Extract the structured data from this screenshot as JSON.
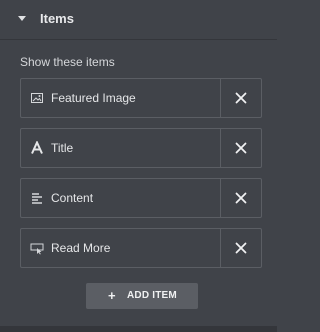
{
  "section": {
    "title": "Items"
  },
  "field": {
    "label": "Show these items"
  },
  "items": [
    {
      "label": "Featured Image",
      "icon": "image-icon"
    },
    {
      "label": "Title",
      "icon": "title-text-icon"
    },
    {
      "label": "Content",
      "icon": "align-left-icon"
    },
    {
      "label": "Read More",
      "icon": "pointer-button-icon"
    }
  ],
  "add_button": {
    "plus": "+",
    "label": "ADD ITEM"
  },
  "colors": {
    "panel_bg": "#404349",
    "border": "#5b5e64",
    "text": "#e5e6e8",
    "button_bg": "#5b5e64"
  }
}
